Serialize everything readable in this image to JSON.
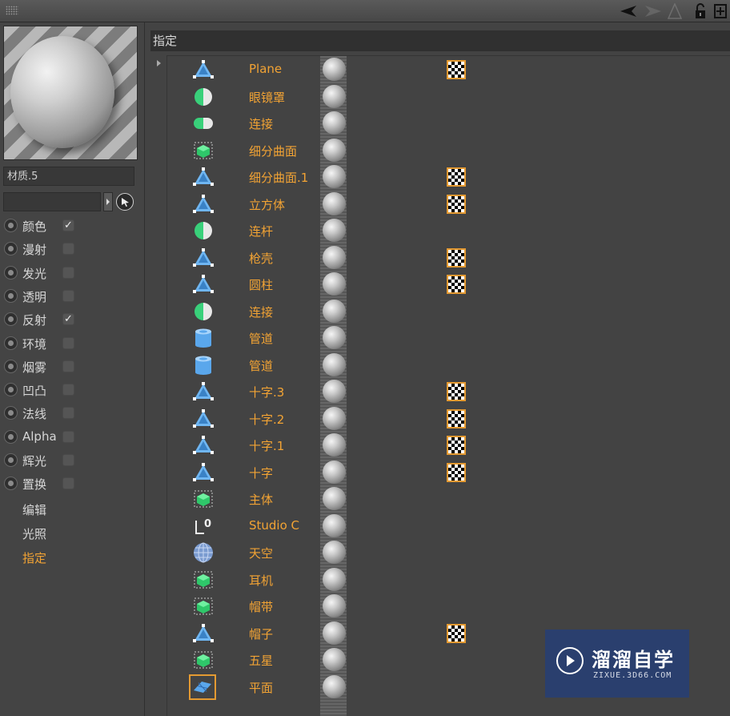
{
  "material": {
    "name": "材质.5",
    "channels": [
      {
        "label": "颜色",
        "checked": true
      },
      {
        "label": "漫射",
        "checked": false
      },
      {
        "label": "发光",
        "checked": false
      },
      {
        "label": "透明",
        "checked": false
      },
      {
        "label": "反射",
        "checked": true
      },
      {
        "label": "环境",
        "checked": false
      },
      {
        "label": "烟雾",
        "checked": false
      },
      {
        "label": "凹凸",
        "checked": false
      },
      {
        "label": "法线",
        "checked": false
      },
      {
        "label": "Alpha",
        "checked": false
      },
      {
        "label": "辉光",
        "checked": false
      },
      {
        "label": "置换",
        "checked": false
      }
    ],
    "sub_items": [
      "编辑",
      "光照",
      "指定"
    ],
    "active_sub": "指定",
    "check_mark": "✓"
  },
  "assign": {
    "header": "指定",
    "objects": [
      {
        "name": "Plane",
        "icon": "polygon-object-icon",
        "texture": true
      },
      {
        "name": "眼镜罩",
        "icon": "half-sphere-icon",
        "texture": false
      },
      {
        "name": "连接",
        "icon": "capsule-icon",
        "texture": false
      },
      {
        "name": "细分曲面",
        "icon": "subdivision-cube-icon",
        "texture": false
      },
      {
        "name": "细分曲面.1",
        "icon": "polygon-object-icon",
        "texture": true
      },
      {
        "name": "立方体",
        "icon": "polygon-object-icon",
        "texture": true
      },
      {
        "name": "连杆",
        "icon": "half-sphere-icon",
        "texture": false
      },
      {
        "name": "枪壳",
        "icon": "polygon-object-icon",
        "texture": true
      },
      {
        "name": "圆柱",
        "icon": "polygon-object-icon",
        "texture": true
      },
      {
        "name": "连接",
        "icon": "half-sphere-icon",
        "texture": false
      },
      {
        "name": "管道",
        "icon": "cylinder-icon",
        "texture": false
      },
      {
        "name": "管道",
        "icon": "cylinder-icon",
        "texture": false
      },
      {
        "name": "十字.3",
        "icon": "polygon-object-icon",
        "texture": true
      },
      {
        "name": "十字.2",
        "icon": "polygon-object-icon",
        "texture": true
      },
      {
        "name": "十字.1",
        "icon": "polygon-object-icon",
        "texture": true
      },
      {
        "name": "十字",
        "icon": "polygon-object-icon",
        "texture": true
      },
      {
        "name": "主体",
        "icon": "subdivision-cube-icon",
        "texture": false
      },
      {
        "name": "Studio C",
        "icon": "null-axis-icon",
        "texture": false
      },
      {
        "name": "天空",
        "icon": "sky-sphere-icon",
        "texture": false
      },
      {
        "name": "耳机",
        "icon": "subdivision-cube-icon",
        "texture": false
      },
      {
        "name": "帽带",
        "icon": "subdivision-cube-icon",
        "texture": false
      },
      {
        "name": "帽子",
        "icon": "polygon-object-icon",
        "texture": true
      },
      {
        "name": "五星",
        "icon": "subdivision-cube-icon",
        "texture": false
      },
      {
        "name": "平面",
        "icon": "plane-icon",
        "texture": false
      }
    ]
  },
  "watermark": {
    "title": "溜溜自学",
    "subtitle": "ZIXUE.3D66.COM"
  },
  "colors": {
    "accent": "#f2a334",
    "background": "#434343",
    "texture_border": "#e49a32"
  }
}
